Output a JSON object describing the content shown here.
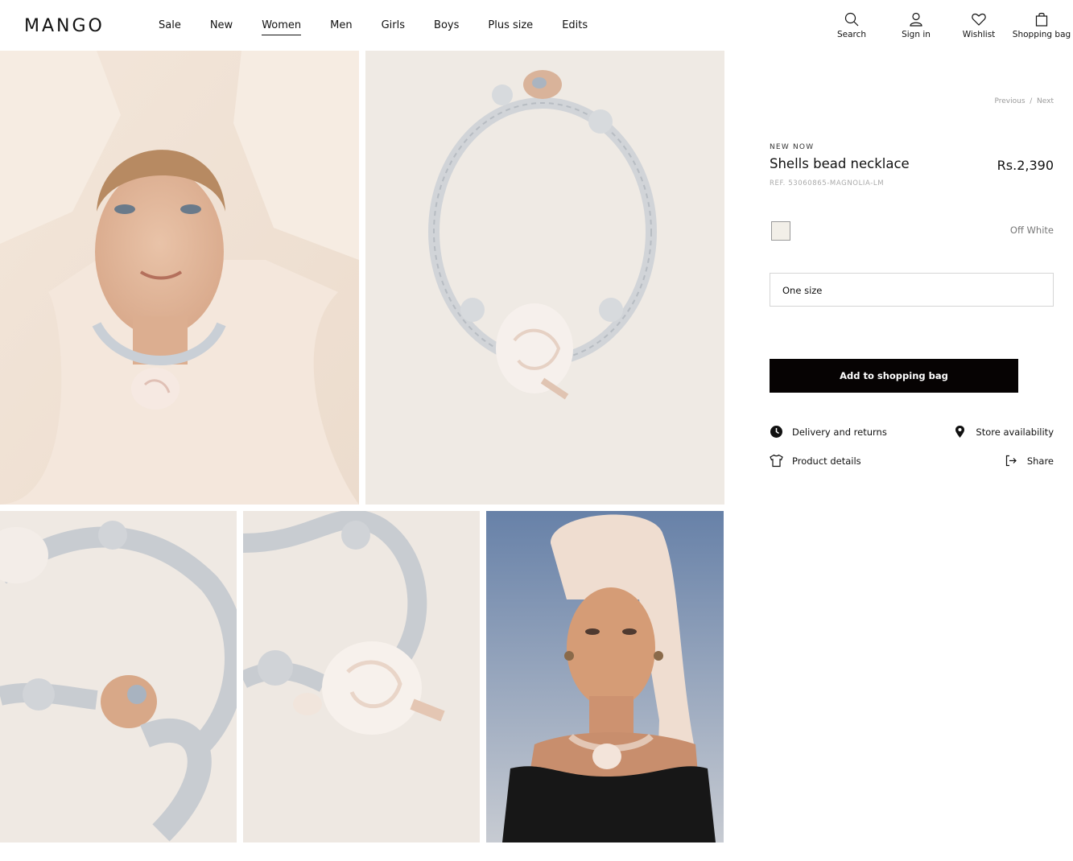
{
  "header": {
    "logo": "MANGO",
    "nav": [
      "Sale",
      "New",
      "Women",
      "Men",
      "Girls",
      "Boys",
      "Plus size",
      "Edits"
    ],
    "active_nav": "Women",
    "tools": {
      "search": "Search",
      "signin": "Sign in",
      "wishlist": "Wishlist",
      "bag": "Shopping bag"
    }
  },
  "product": {
    "prev": "Previous",
    "sep": "/",
    "next": "Next",
    "badge": "NEW NOW",
    "title": "Shells bead necklace",
    "price": "Rs.2,390",
    "ref": "REF. 53060865-MAGNOLIA-LM",
    "color_name": "Off White",
    "color_hex": "#f2efe8",
    "size": "One size",
    "add_to_bag": "Add to shopping bag",
    "links": {
      "delivery": "Delivery and returns",
      "store": "Store availability",
      "details": "Product details",
      "share": "Share"
    }
  },
  "gallery": {
    "icons": [
      "model-portrait-photo",
      "necklace-flatlay-photo",
      "necklace-closeup-photo",
      "shell-closeup-photo",
      "model-towel-photo"
    ]
  }
}
